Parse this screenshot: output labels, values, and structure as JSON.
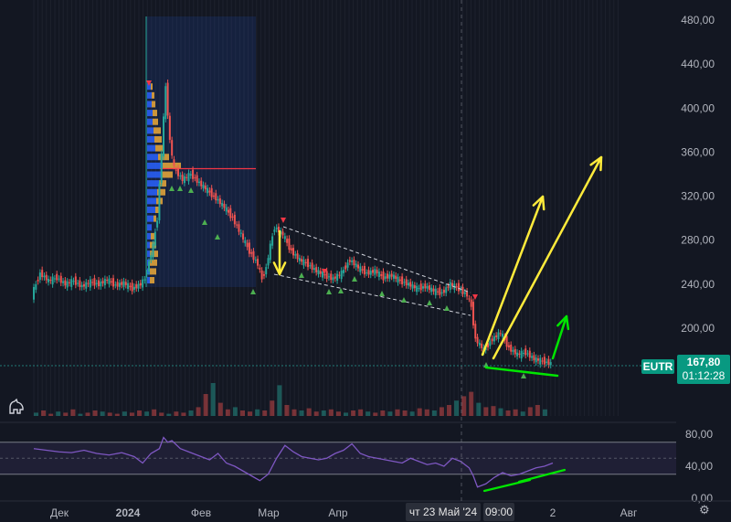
{
  "chart_data": {
    "type": "candlestick",
    "symbol": "EUTR",
    "last_price": "167,80",
    "countdown": "01:12:28",
    "crosshair_date": "чт 23 Май '24",
    "crosshair_time": "09:00",
    "price_axis": {
      "ticks": [
        "480,00",
        "440,00",
        "400,00",
        "360,00",
        "320,00",
        "280,00",
        "240,00",
        "200,00"
      ],
      "range": [
        165,
        488
      ]
    },
    "rsi_axis": {
      "ticks": [
        "80,00",
        "40,00",
        "0,00"
      ],
      "range": [
        0,
        88
      ],
      "band": [
        30,
        70
      ]
    },
    "x_ticks": [
      "Дек",
      "2024",
      "Фев",
      "Мар",
      "Апр",
      "Май",
      "2",
      "Авг"
    ],
    "price_path": [
      [
        0,
        230
      ],
      [
        2,
        250
      ],
      [
        4,
        243
      ],
      [
        6,
        246
      ],
      [
        8,
        240
      ],
      [
        10,
        243
      ],
      [
        12,
        238
      ],
      [
        14,
        242
      ],
      [
        16,
        240
      ],
      [
        18,
        244
      ],
      [
        20,
        239
      ],
      [
        22,
        241
      ],
      [
        24,
        236
      ],
      [
        26,
        240
      ],
      [
        27,
        245
      ],
      [
        28,
        260
      ],
      [
        29,
        275
      ],
      [
        30,
        300
      ],
      [
        31,
        360
      ],
      [
        32,
        420
      ],
      [
        33,
        370
      ],
      [
        34,
        345
      ],
      [
        36,
        335
      ],
      [
        38,
        340
      ],
      [
        40,
        332
      ],
      [
        42,
        325
      ],
      [
        44,
        318
      ],
      [
        46,
        310
      ],
      [
        48,
        300
      ],
      [
        50,
        285
      ],
      [
        52,
        270
      ],
      [
        54,
        258
      ],
      [
        55,
        245
      ],
      [
        56,
        255
      ],
      [
        57,
        275
      ],
      [
        58,
        292
      ],
      [
        60,
        285
      ],
      [
        62,
        270
      ],
      [
        64,
        262
      ],
      [
        66,
        258
      ],
      [
        68,
        252
      ],
      [
        70,
        248
      ],
      [
        72,
        245
      ],
      [
        74,
        250
      ],
      [
        76,
        262
      ],
      [
        78,
        255
      ],
      [
        80,
        250
      ],
      [
        82,
        252
      ],
      [
        84,
        246
      ],
      [
        86,
        248
      ],
      [
        88,
        243
      ],
      [
        90,
        240
      ],
      [
        92,
        236
      ],
      [
        94,
        238
      ],
      [
        96,
        234
      ],
      [
        98,
        232
      ],
      [
        100,
        240
      ],
      [
        102,
        236
      ],
      [
        104,
        230
      ],
      [
        105,
        220
      ],
      [
        106,
        190
      ],
      [
        108,
        180
      ],
      [
        110,
        190
      ],
      [
        112,
        196
      ],
      [
        114,
        182
      ],
      [
        116,
        176
      ],
      [
        118,
        178
      ],
      [
        120,
        172
      ],
      [
        122,
        170
      ],
      [
        124,
        168
      ]
    ],
    "volume_profile": [
      {
        "price": 420,
        "buy": 4,
        "sell": 2
      },
      {
        "price": 412,
        "buy": 5,
        "sell": 3
      },
      {
        "price": 404,
        "buy": 5,
        "sell": 4
      },
      {
        "price": 396,
        "buy": 6,
        "sell": 5
      },
      {
        "price": 388,
        "buy": 6,
        "sell": 6
      },
      {
        "price": 380,
        "buy": 7,
        "sell": 8
      },
      {
        "price": 372,
        "buy": 8,
        "sell": 8
      },
      {
        "price": 364,
        "buy": 9,
        "sell": 10
      },
      {
        "price": 356,
        "buy": 12,
        "sell": 12
      },
      {
        "price": 348,
        "buy": 17,
        "sell": 20
      },
      {
        "price": 340,
        "buy": 16,
        "sell": 12
      },
      {
        "price": 332,
        "buy": 13,
        "sell": 8
      },
      {
        "price": 324,
        "buy": 11,
        "sell": 9
      },
      {
        "price": 316,
        "buy": 10,
        "sell": 7
      },
      {
        "price": 308,
        "buy": 9,
        "sell": 5
      },
      {
        "price": 300,
        "buy": 7,
        "sell": 3
      },
      {
        "price": 292,
        "buy": 5,
        "sell": 0
      },
      {
        "price": 284,
        "buy": 4,
        "sell": 5
      },
      {
        "price": 276,
        "buy": 3,
        "sell": 7
      },
      {
        "price": 268,
        "buy": 3,
        "sell": 9
      },
      {
        "price": 260,
        "buy": 3,
        "sell": 8
      },
      {
        "price": 252,
        "buy": 3,
        "sell": 7
      },
      {
        "price": 244,
        "buy": 3,
        "sell": 5
      }
    ],
    "poc_price": 345,
    "rsi": [
      [
        0,
        62
      ],
      [
        3,
        60
      ],
      [
        6,
        58
      ],
      [
        9,
        57
      ],
      [
        12,
        60
      ],
      [
        15,
        56
      ],
      [
        18,
        54
      ],
      [
        21,
        57
      ],
      [
        24,
        52
      ],
      [
        26,
        44
      ],
      [
        28,
        56
      ],
      [
        30,
        62
      ],
      [
        31,
        76
      ],
      [
        32,
        70
      ],
      [
        33,
        72
      ],
      [
        35,
        62
      ],
      [
        38,
        56
      ],
      [
        40,
        52
      ],
      [
        42,
        48
      ],
      [
        44,
        56
      ],
      [
        46,
        44
      ],
      [
        48,
        40
      ],
      [
        50,
        34
      ],
      [
        52,
        28
      ],
      [
        54,
        22
      ],
      [
        56,
        30
      ],
      [
        58,
        50
      ],
      [
        60,
        66
      ],
      [
        62,
        58
      ],
      [
        64,
        52
      ],
      [
        66,
        50
      ],
      [
        68,
        48
      ],
      [
        70,
        50
      ],
      [
        72,
        56
      ],
      [
        74,
        60
      ],
      [
        76,
        68
      ],
      [
        78,
        56
      ],
      [
        80,
        52
      ],
      [
        82,
        50
      ],
      [
        84,
        48
      ],
      [
        86,
        46
      ],
      [
        88,
        44
      ],
      [
        90,
        50
      ],
      [
        92,
        46
      ],
      [
        94,
        42
      ],
      [
        96,
        44
      ],
      [
        98,
        40
      ],
      [
        100,
        50
      ],
      [
        102,
        46
      ],
      [
        104,
        38
      ],
      [
        105,
        28
      ],
      [
        106,
        14
      ],
      [
        108,
        18
      ],
      [
        110,
        26
      ],
      [
        112,
        32
      ],
      [
        114,
        28
      ],
      [
        116,
        30
      ],
      [
        118,
        34
      ],
      [
        120,
        38
      ],
      [
        122,
        40
      ],
      [
        124,
        44
      ]
    ],
    "volume": [
      3,
      5,
      2,
      4,
      3,
      6,
      2,
      3,
      5,
      4,
      3,
      2,
      4,
      3,
      5,
      4,
      6,
      3,
      2,
      4,
      3,
      5,
      8,
      20,
      30,
      12,
      6,
      8,
      5,
      4,
      6,
      5,
      14,
      28,
      10,
      6,
      5,
      7,
      4,
      5,
      6,
      4,
      3,
      5,
      6,
      4,
      3,
      5,
      4,
      6,
      5,
      4,
      7,
      6,
      5,
      8,
      10,
      14,
      18,
      22,
      12,
      8,
      9,
      7,
      5,
      6,
      4,
      8,
      10,
      6
    ]
  },
  "colors": {
    "up": "#26a69a",
    "down": "#ef5350",
    "rsi_line": "#7e57c2",
    "annotation_yellow": "#ffeb3b",
    "annotation_green": "#00e600",
    "poc_line": "#f23645",
    "background": "#131722"
  },
  "icons": {
    "logo": "tradingview-logo-icon",
    "settings": "gear-icon"
  }
}
